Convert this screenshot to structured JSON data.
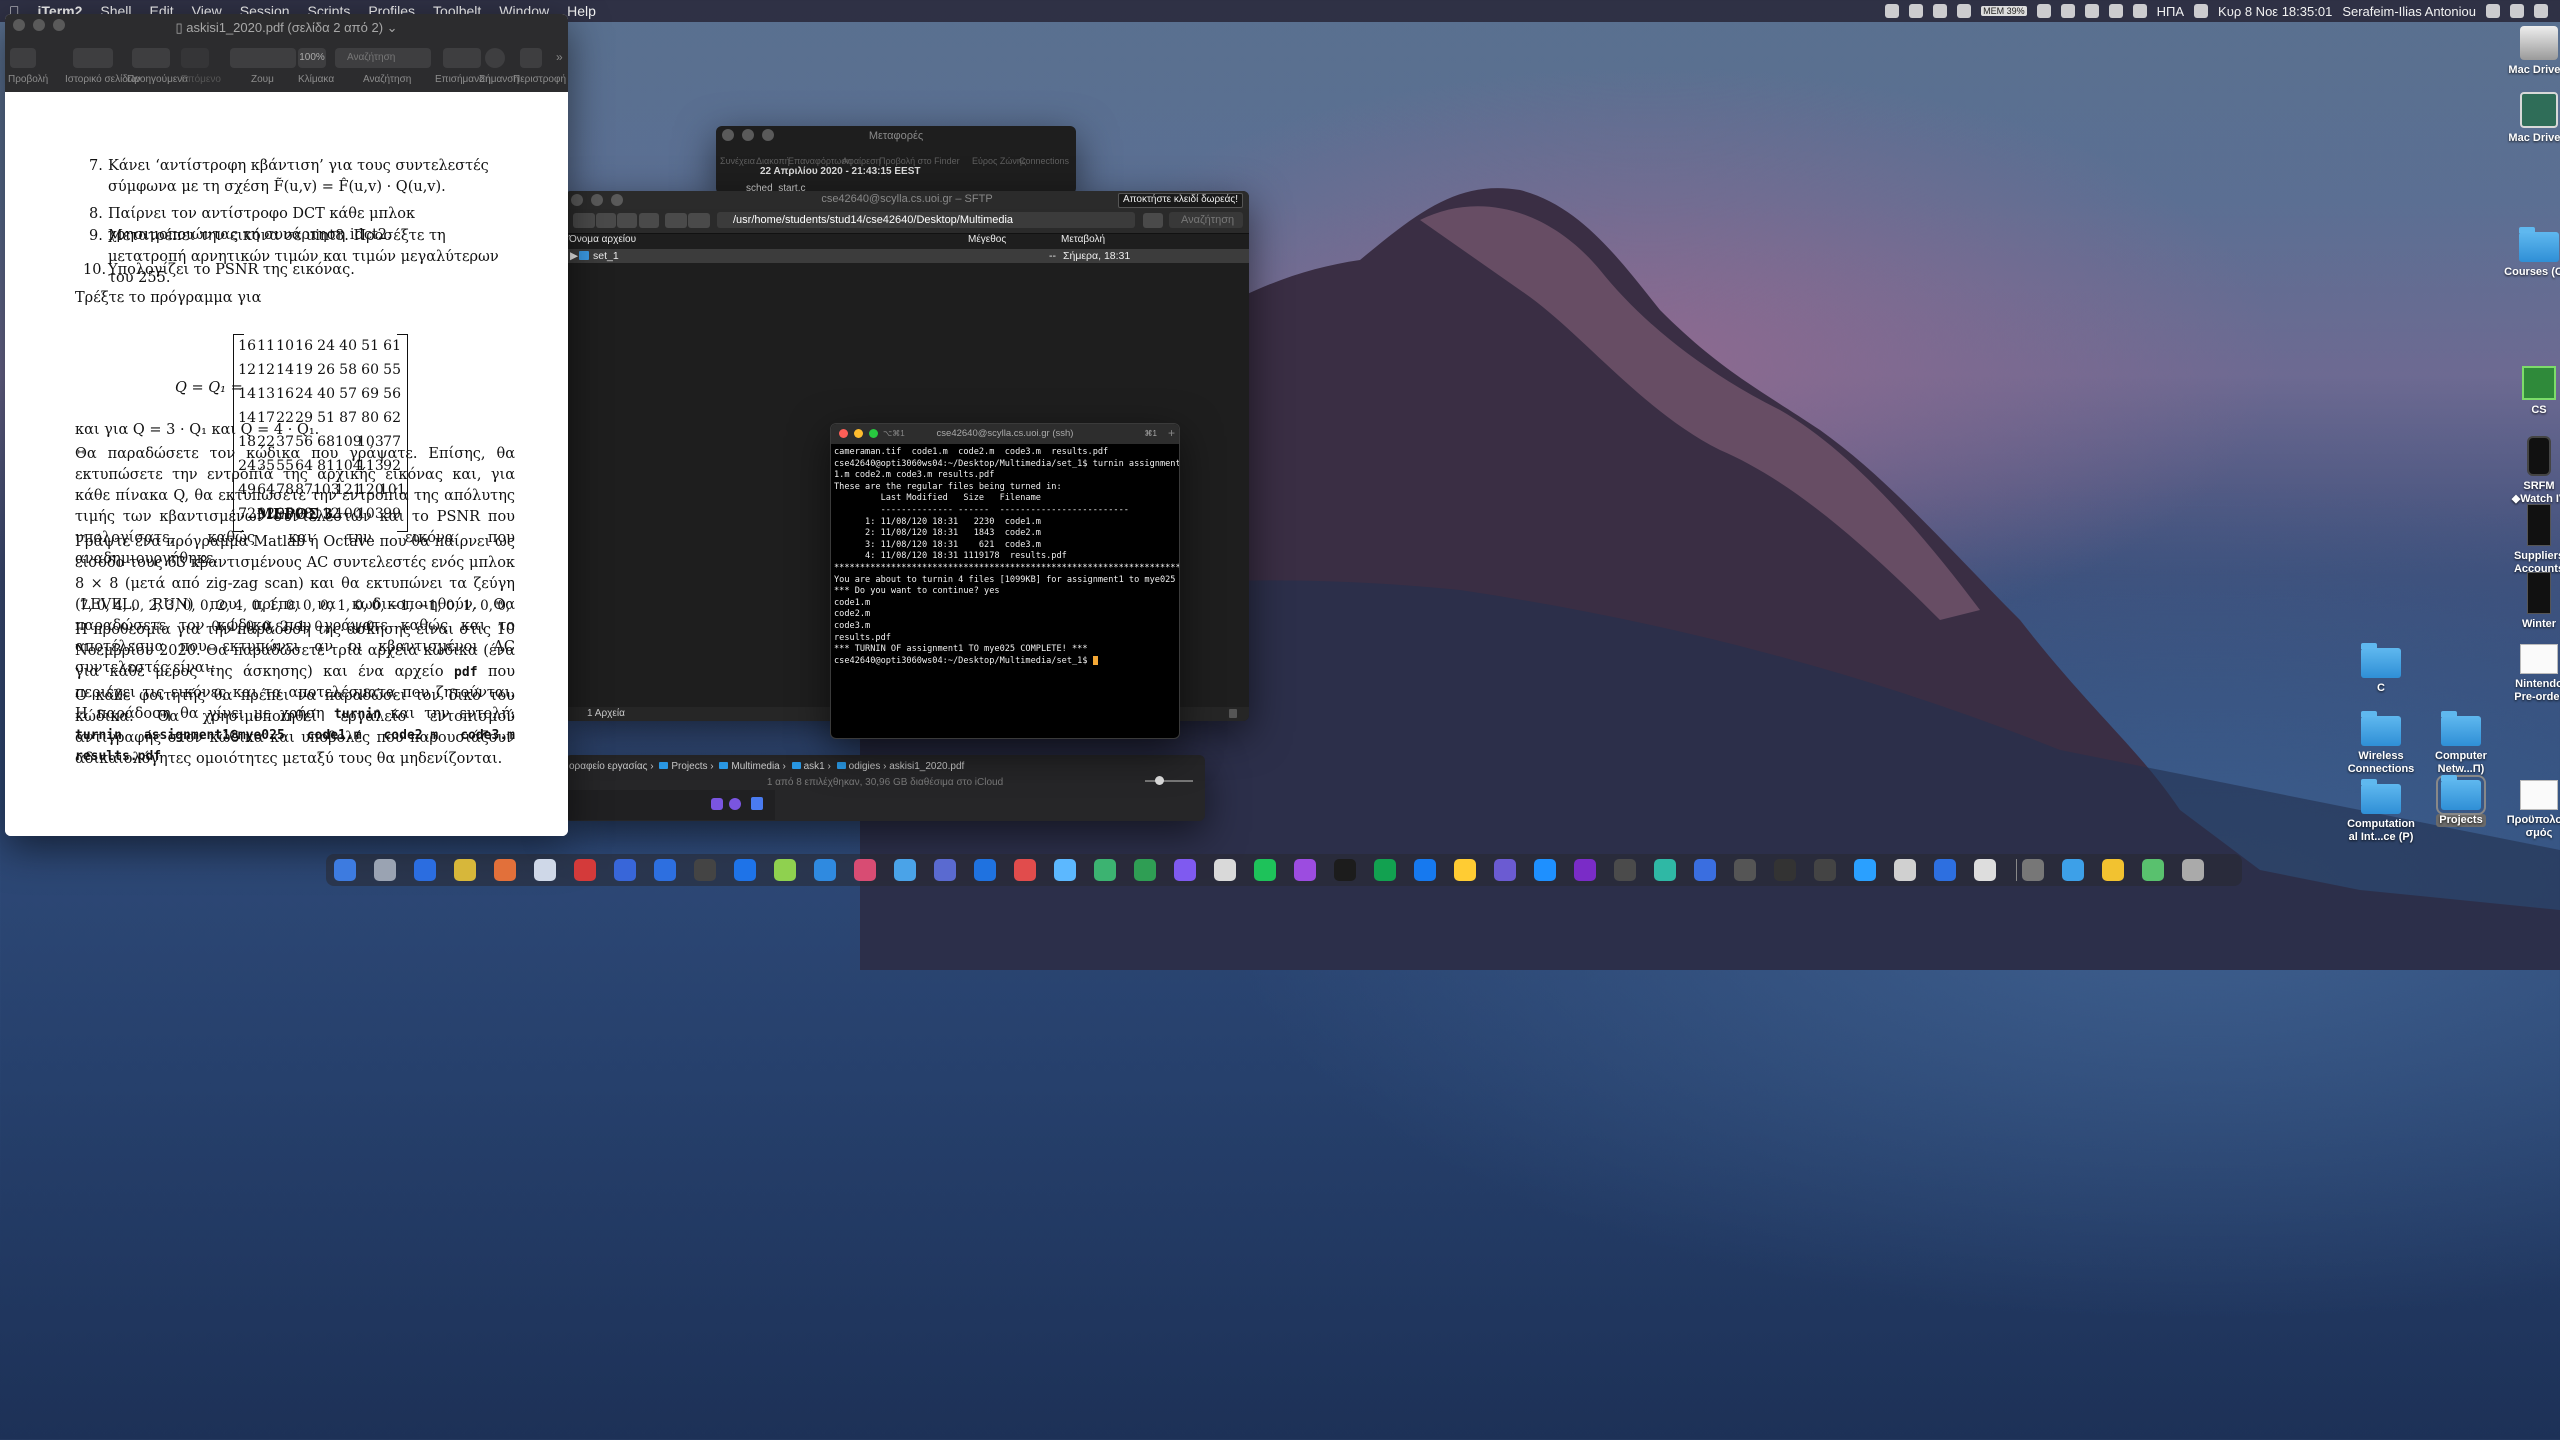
{
  "menubar": {
    "app": "iTerm2",
    "items": [
      "Shell",
      "Edit",
      "View",
      "Session",
      "Scripts",
      "Profiles",
      "Toolbelt",
      "Window",
      "Help"
    ],
    "battery_label": "MEM 39%",
    "input_source": "ΗΠΑ",
    "datetime": "Κυρ 8 Νοε  18:35:01",
    "user": "Serafeim-Ilias Antoniou"
  },
  "preview": {
    "title": "askisi1_2020.pdf (σελίδα 2 από 2)",
    "toolbar_labels": [
      "Προβολή",
      "Ιστορικό σελίδων",
      "Προηγούμενα",
      "Επόμενο",
      "Ζουμ",
      "Κλίμακα",
      "Αναζήτηση",
      "Επισήμανση",
      "Σήμανση",
      "Περιστροφή"
    ],
    "zoom": "100%",
    "search_placeholder": "Αναζήτηση",
    "list": [
      {
        "n": "7.",
        "t": "Κάνει ‘αντίστροφη κβάντιση’ για τους συντελεστές σύμφωνα με τη σχέση F̃(u,v) = F̂(u,v) · Q(u,v)."
      },
      {
        "n": "8.",
        "t": "Παίρνει τον αντίστροφο DCT κάθε μπλοκ χρησιμοποιώντας τη συνάρτηση idct2."
      },
      {
        "n": "9.",
        "t": "Μετατρέπει την εικόνα σε uint8. Προσέξτε τη μετατροπή αρνητικών τιμών και τιμών μεγαλύτερων του 255."
      },
      {
        "n": "10.",
        "t": "Υπολογίζει το PSNR της εικόνας."
      }
    ],
    "run_for": "Τρέξτε το πρόγραμμα για",
    "matrix_lhs": "Q = Q₁ =",
    "matrix": [
      [
        "16",
        "11",
        "10",
        "16",
        "24",
        "40",
        "51",
        "61"
      ],
      [
        "12",
        "12",
        "14",
        "19",
        "26",
        "58",
        "60",
        "55"
      ],
      [
        "14",
        "13",
        "16",
        "24",
        "40",
        "57",
        "69",
        "56"
      ],
      [
        "14",
        "17",
        "22",
        "29",
        "51",
        "87",
        "80",
        "62"
      ],
      [
        "18",
        "22",
        "37",
        "56",
        "68",
        "109",
        "103",
        "77"
      ],
      [
        "24",
        "35",
        "55",
        "64",
        "81",
        "104",
        "113",
        "92"
      ],
      [
        "49",
        "64",
        "78",
        "87",
        "103",
        "121",
        "120",
        "101"
      ],
      [
        "72",
        "92",
        "95",
        "98",
        "112",
        "100",
        "103",
        "99"
      ]
    ],
    "and_q": "και για Q = 3 · Q₁ και Q = 4 · Q₁.",
    "para1": "Θα παραδώσετε τον κώδικα που γράψατε. Επίσης, θα εκτυπώσετε την εντροπία της αρχικής εικόνας και, για κάθε πίνακα Q, θα εκτυπώσετε την εντροπία της απόλυτης τιμής των κβαντισμένων συντελεστών και το PSNR που υπολογίσατε, καθώς και την εικόνα που αναδημιουργήθηκε.",
    "section": "ΜΕΡΟΣ 3",
    "para2": "Γράψτε ένα πρόγραμμα Matlab ή Octave που θα παίρνει ως είσοδο τους 63 κβαντισμένους AC συντελεστές ενός μπλοκ 8 × 8 (μετά από zig-zag scan) και θα εκτυπώνει τα ζεύγη (LEVEL, RUN) που πρέπει να κωδικοποιηθούν. Θα παραδώσετε τον κώδικα που γράψατε καθώς και το αποτέλεσμα που εκτυπώνει αν οι κβαντισμένοι AC συντελεστές είναι:",
    "sequence": "7, 0, 4, 0, 2, 3, 0, 0, 2, 4, 0, 1, 0, 0, 0, 1, 0, 0, −1, −1, 0, 1, 0, 0, 0, 1, 0, 0, 2, 1, 0, . . . , 0.",
    "para3a": "Η προθεσμία για την παράδοση της άσκησης είναι στις 10 Νοεμβρίου 2020. Θα παραδώσετε τρία αρχεία κώδικα (ένα για κάθε μέρος της άσκησης) και ένα αρχείο",
    "pdf_word": "pdf",
    "para3b": "που περιέχει τις εικόνες και τα αποτελέσματα που ζητούνται. Η παράδοση θα γίνει με χρήση",
    "turnin_word": "turnin",
    "para3c": "και την εντολή:",
    "command": "turnin assignment1@mye025 code1.m code2.m code3.m results.pdf",
    "para4": "Ο κάθε φοιτητής θα πρέπει να παραδώσει τον δικό του κώδικα. Θα χρησιμοποιηθεί εργαλείο εντοπισμού αντιγραφής στον κώδικα και υποβολές που παρουσιάζουν αδικαιολόγητες ομοιότητες μεταξύ τους θα μηδενίζονται."
  },
  "transfers": {
    "title": "Μεταφορές",
    "labels": [
      "Συνέχεια",
      "Διακοπή",
      "Επαναφόρτωση",
      "Αφαίρεση",
      "Προβολή στο Finder",
      "Εύρος Ζώνης",
      "Connections"
    ],
    "date": "22 Απριλίου 2020 - 21:43:15 EEST",
    "file": "sched_start.c"
  },
  "sftp": {
    "title": "cse42640@scylla.cs.uoi.gr – SFTP",
    "promo": "Αποκτήστε κλειδί δωρεάς!",
    "path": "/usr/home/students/stud14/cse42640/Desktop/Multimedia",
    "search_placeholder": "Αναζήτηση",
    "columns": [
      "Όνομα αρχείου",
      "Μέγεθος",
      "Μεταβολή"
    ],
    "rows": [
      {
        "name": "set_1",
        "size": "--",
        "modified": "Σήμερα, 18:31"
      }
    ],
    "footer": "1 Αρχεία"
  },
  "finder": {
    "path": [
      "οραφείο εργασίας",
      "Projects",
      "Multimedia",
      "ask1",
      "odigies",
      "askisi1_2020.pdf"
    ],
    "status": "1 από 8 επιλέχθηκαν, 30,96 GB διαθέσιμα στο iCloud"
  },
  "terminal": {
    "title": "cse42640@scylla.cs.uoi.gr (ssh)",
    "shortcut_left": "⌥⌘1",
    "shortcut_right": "⌘1",
    "lines": [
      "cameraman.tif  code1.m  code2.m  code3.m  results.pdf",
      "cse42640@opti3060ws04:~/Desktop/Multimedia/set_1$ turnin assignment1@mye025 code",
      "1.m code2.m code3.m results.pdf",
      "",
      "These are the regular files being turned in:",
      "",
      "         Last Modified   Size   Filename",
      "         -------------- ------  -------------------------",
      "      1: 11/08/120 18:31   2230  code1.m",
      "      2: 11/08/120 18:31   1843  code2.m",
      "      3: 11/08/120 18:31    621  code3.m",
      "      4: 11/08/120 18:31 1119178  results.pdf",
      "",
      "*************************************************************************",
      "",
      "You are about to turnin 4 files [1099KB] for assignment1 to mye025",
      "",
      "*** Do you want to continue? yes",
      "code1.m",
      "code2.m",
      "code3.m",
      "results.pdf",
      "",
      "*** TURNIN OF assignment1 TO mye025 COMPLETE! ***"
    ],
    "prompt": "cse42640@opti3060ws04:~/Desktop/Multimedia/set_1$ "
  },
  "desktop": {
    "icons": [
      {
        "label": "Mac Drive 1"
      },
      {
        "label": "Mac Drive 2"
      },
      {
        "label": "Courses (CS)"
      },
      {
        "label": "CS"
      },
      {
        "label": "SRFM ◆Watch IV"
      },
      {
        "label": "Suppliers Accounts"
      },
      {
        "label": "Winter"
      },
      {
        "label": "C"
      },
      {
        "label": "Nintendo Pre-order"
      },
      {
        "label": "Wireless Connections"
      },
      {
        "label": "Computer Netw...Π)"
      },
      {
        "label": "Computation al Int...ce (P)"
      },
      {
        "label": "Projects"
      },
      {
        "label": "Προϋπολογι σμός"
      }
    ]
  }
}
